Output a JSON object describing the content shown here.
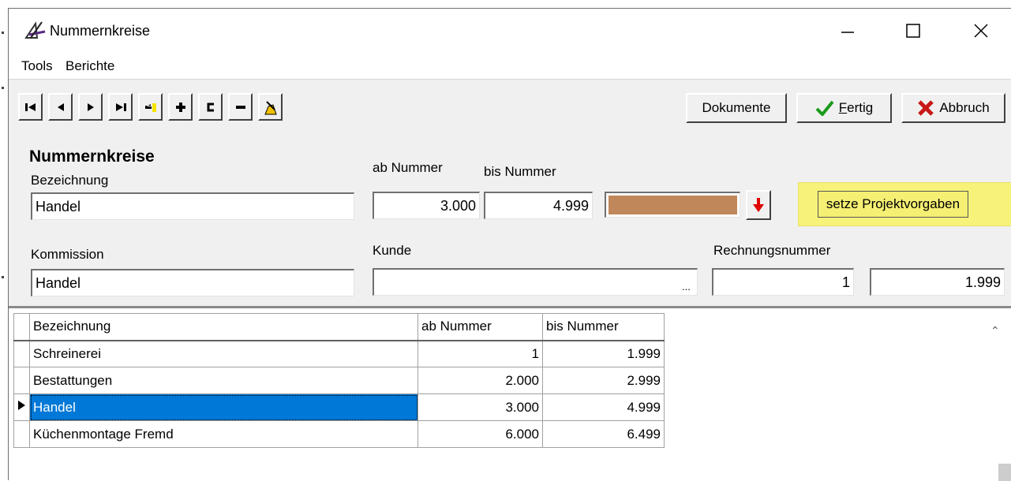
{
  "window": {
    "title": "Nummernkreise"
  },
  "menu": {
    "tools": "Tools",
    "berichte": "Berichte"
  },
  "toolbar": {
    "dokumente": "Dokumente",
    "fertig_first": "F",
    "fertig_rest": "ertig",
    "abbruch": "Abbruch"
  },
  "form": {
    "section_title": "Nummernkreise",
    "bezeichnung_label": "Bezeichnung",
    "bezeichnung_value": "Handel",
    "ab_nummer_label": "ab Nummer",
    "bis_nummer_label": "bis Nummer",
    "ab_nummer_value": "3.000",
    "bis_nummer_value": "4.999",
    "color": "#c0875a",
    "projekt_button": "setze Projektvorgaben",
    "kommission_label": "Kommission",
    "kommission_value": "Handel",
    "kunde_label": "Kunde",
    "kunde_value": "",
    "kunde_ellipsis": "...",
    "rechnungsnummer_label": "Rechnungsnummer",
    "rechnung_von": "1",
    "rechnung_bis": "1.999"
  },
  "grid": {
    "headers": [
      "Bezeichnung",
      "ab Nummer",
      "bis Nummer"
    ],
    "rows": [
      {
        "bezeichnung": "Schreinerei",
        "ab": "1",
        "bis": "1.999"
      },
      {
        "bezeichnung": "Bestattungen",
        "ab": "2.000",
        "bis": "2.999"
      },
      {
        "bezeichnung": "Handel",
        "ab": "3.000",
        "bis": "4.999"
      },
      {
        "bezeichnung": "Küchenmontage Fremd",
        "ab": "6.000",
        "bis": "6.499"
      }
    ]
  },
  "colors": {
    "accent_selection": "#0078d7",
    "highlight_button": "#f7f37a"
  }
}
